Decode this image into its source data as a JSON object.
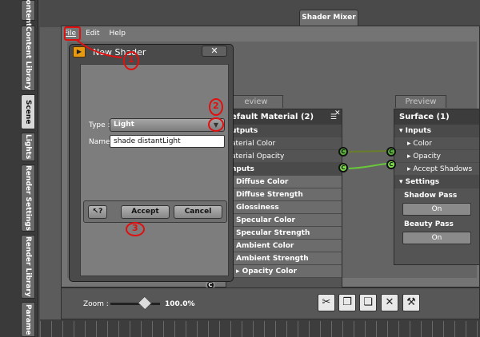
{
  "sidebar": {
    "tabs": [
      {
        "label": "Content"
      },
      {
        "label": "Content Library"
      },
      {
        "label": "Scene"
      },
      {
        "label": "Lights"
      },
      {
        "label": "Render Settings"
      },
      {
        "label": "Render Library"
      },
      {
        "label": "Parame"
      }
    ]
  },
  "window": {
    "tab_title": "Shader Mixer"
  },
  "menubar": {
    "file": "File",
    "edit": "Edit",
    "help": "Help"
  },
  "dialog": {
    "title": "New Shader",
    "close_label": "✕",
    "type_label": "Type :",
    "type_value": "Light",
    "name_label": "Name :",
    "name_value": "shade distantLight",
    "help_label": "↖?",
    "accept_label": "Accept",
    "cancel_label": "Cancel"
  },
  "default_material": {
    "preview_label": "eview",
    "title": "efault Material (2)",
    "outputs_header": "utputs",
    "outputs": [
      "aterial Color",
      "aterial Opacity"
    ],
    "inputs_header": "nputs",
    "inputs": [
      "Diffuse Color",
      "Diffuse Strength",
      "Glossiness",
      "Specular Color",
      "Specular Strength",
      "Ambient Color",
      "Ambient Strength",
      "Opacity Color"
    ]
  },
  "surface": {
    "preview_label": "Preview",
    "title": "Surface (1)",
    "inputs_header": "Inputs",
    "inputs": [
      "Color",
      "Opacity",
      "Accept Shadows"
    ],
    "settings_header": "Settings",
    "shadow_pass_label": "Shadow Pass",
    "shadow_pass_value": "On",
    "beauty_pass_label": "Beauty Pass",
    "beauty_pass_value": "On"
  },
  "bottom": {
    "zoom_label": "Zoom :",
    "zoom_value": "100.0%"
  },
  "annotations": [
    "1",
    "2",
    "3"
  ],
  "colors": {
    "connector": "#5ab53a",
    "annotation": "#e01010",
    "dialog_icon": "#e89a12"
  }
}
